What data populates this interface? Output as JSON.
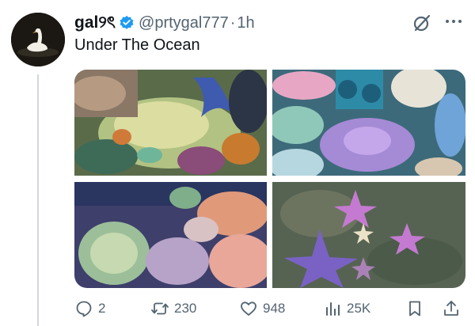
{
  "tweet": {
    "display_name": "gal୨ৎ",
    "handle": "@prtygal777",
    "separator": "·",
    "time": "1h",
    "text": "Under The Ocean"
  },
  "actions": {
    "replies": "2",
    "retweets": "230",
    "likes": "948",
    "views": "25K"
  },
  "media": [
    "tide-pool-photo",
    "coral-anemones-photo",
    "coral-reef-photo",
    "starfish-photo"
  ],
  "colors": {
    "text_primary": "#0f1419",
    "text_secondary": "#536471",
    "verified_blue": "#1d9bf0",
    "thread_line": "#cfd9de"
  }
}
